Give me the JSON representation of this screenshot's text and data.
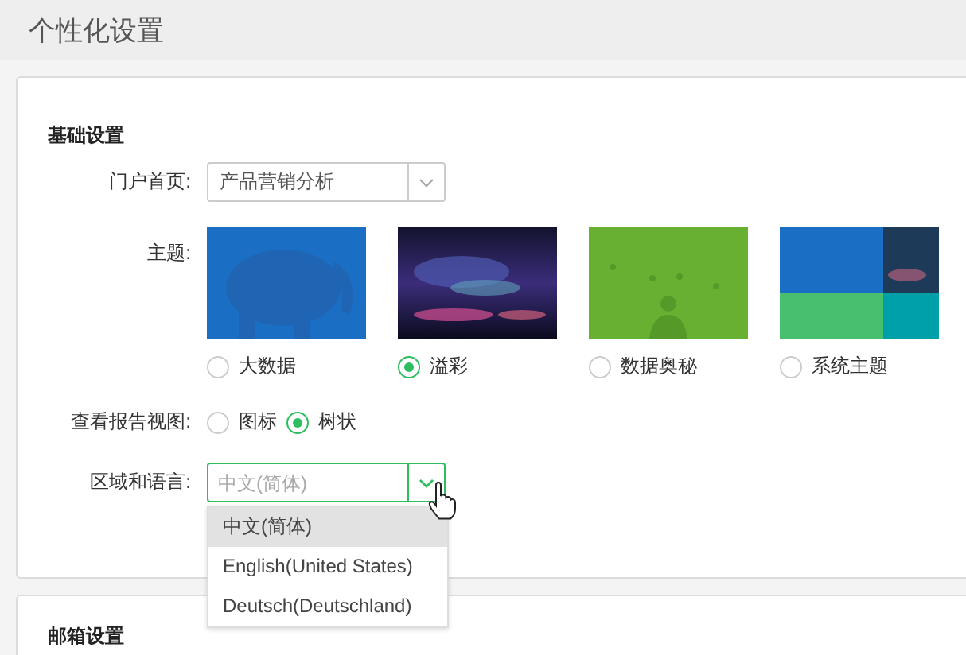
{
  "page_title": "个性化设置",
  "basic_settings": {
    "title": "基础设置",
    "portal_home": {
      "label": "门户首页:",
      "value": "产品营销分析"
    },
    "theme": {
      "label": "主题:",
      "options": [
        {
          "name": "大数据",
          "selected": false
        },
        {
          "name": "溢彩",
          "selected": true
        },
        {
          "name": "数据奥秘",
          "selected": false
        },
        {
          "name": "系统主题",
          "selected": false
        }
      ]
    },
    "report_view": {
      "label": "查看报告视图:",
      "options": [
        {
          "label": "图标",
          "selected": false
        },
        {
          "label": "树状",
          "selected": true
        }
      ]
    },
    "locale": {
      "label": "区域和语言:",
      "placeholder": "中文(简体)",
      "focused": true,
      "expanded": true,
      "dropdown": [
        {
          "label": "中文(简体)",
          "selected": true
        },
        {
          "label": "English(United States)",
          "selected": false
        },
        {
          "label": "Deutsch(Deutschland)",
          "selected": false
        }
      ]
    }
  },
  "mail_settings": {
    "title": "邮箱设置"
  }
}
